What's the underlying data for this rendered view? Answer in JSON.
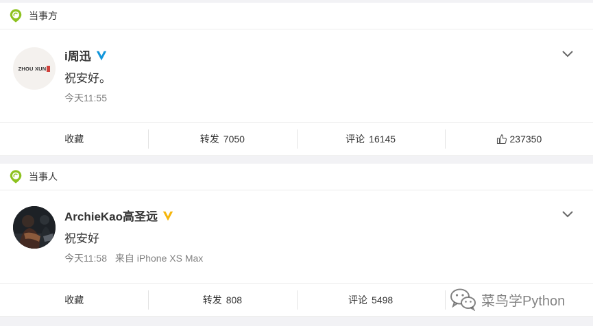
{
  "cards": [
    {
      "section_label": "当事方",
      "avatar_text": "ZHOU XUN",
      "name": "i周迅",
      "verify_color": "#1296db",
      "text": "祝安好。",
      "time": "今天11:55",
      "source": "",
      "actions": {
        "collect": "收藏",
        "repost_label": "转发",
        "repost_count": "7050",
        "comment_label": "评论",
        "comment_count": "16145",
        "like_count": "237350"
      }
    },
    {
      "section_label": "当事人",
      "name": "ArchieKao高圣远",
      "verify_color": "#f6b60b",
      "text": "祝安好",
      "time": "今天11:58",
      "source": "来自 iPhone XS Max",
      "actions": {
        "collect": "收藏",
        "repost_label": "转发",
        "repost_count": "808",
        "comment_label": "评论",
        "comment_count": "5498"
      }
    }
  ],
  "watermark": {
    "text": "菜鸟学Python"
  },
  "colors": {
    "badge_green": "#8dc21f",
    "muted": "#808080"
  }
}
